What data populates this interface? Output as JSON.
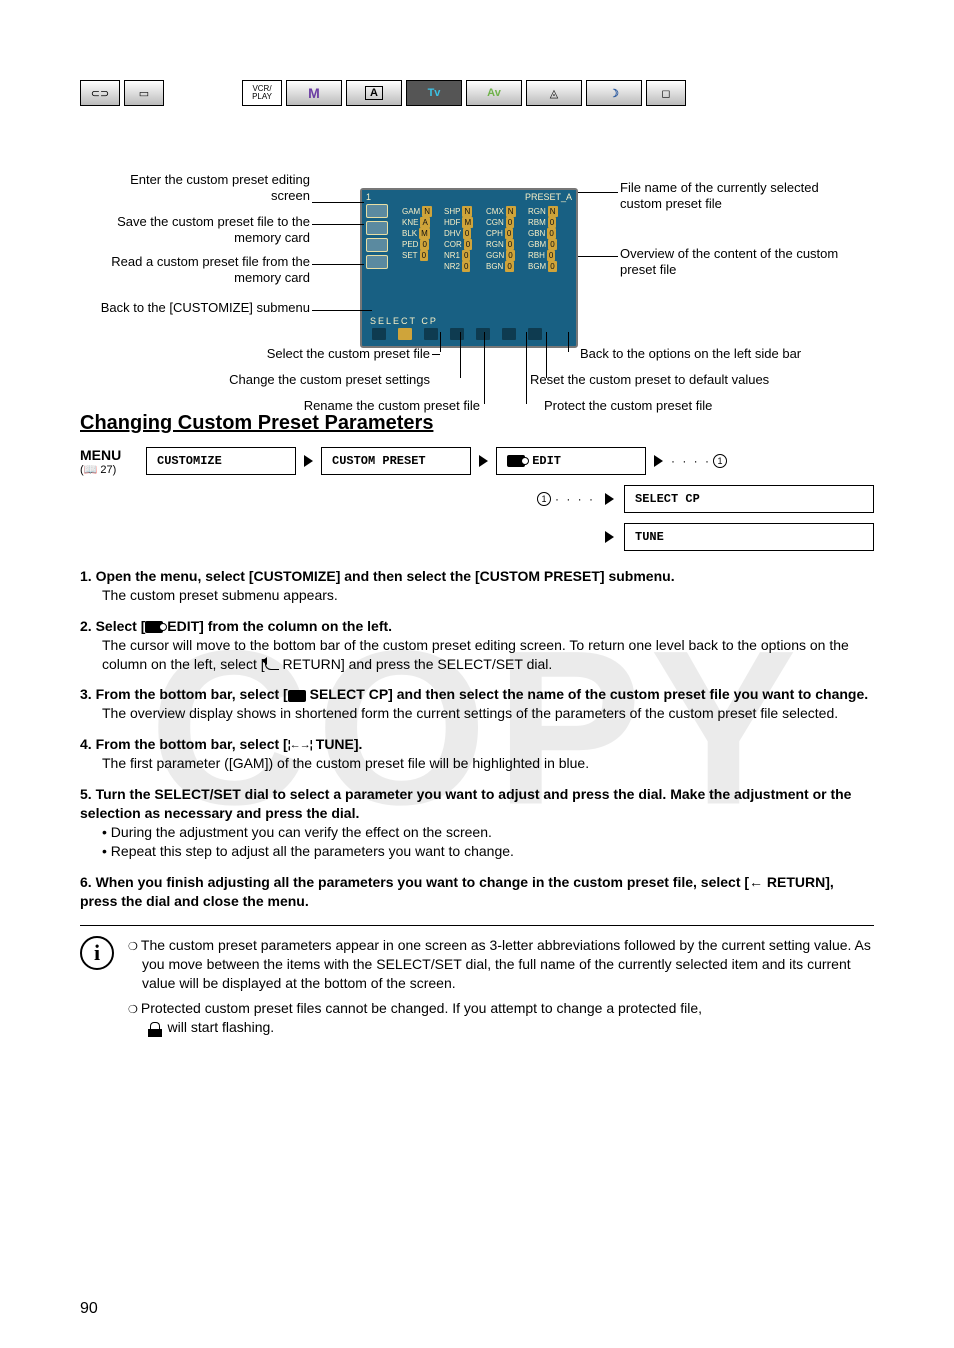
{
  "modebar": {
    "tape": "⊂⊃",
    "card": "▭",
    "vcr": "VCR/\nPLAY",
    "m": "M",
    "a": "A",
    "tv": "Tv",
    "av": "Av",
    "spot": "◬",
    "night": "☽",
    "rec": "◻"
  },
  "diagram": {
    "left": {
      "l1": "Enter the custom preset editing screen",
      "l2": "Save the custom preset file to the memory card",
      "l3": "Read a custom preset file from the memory card",
      "l4": "Back to the [CUSTOMIZE] submenu"
    },
    "right": {
      "r1": "File name of the currently selected custom preset file",
      "r2": "Overview of the content of the custom preset file"
    },
    "bottom": {
      "b1": "Select the custom preset file",
      "b2": "Change the custom preset settings",
      "b3": "Rename the custom preset file",
      "b4": "Protect the custom preset file",
      "b5": "Reset the custom preset to default values",
      "b6": "Back to the options on the left side bar"
    },
    "screen": {
      "title_num": "1",
      "title_name": "PRESET_A",
      "rows": [
        [
          [
            "GAM",
            "N"
          ],
          [
            "SHP",
            "N"
          ],
          [
            "CMX",
            "N"
          ],
          [
            "RGN",
            "N"
          ]
        ],
        [
          [
            "KNE",
            "A"
          ],
          [
            "HDF",
            "M"
          ],
          [
            "CGN",
            "0"
          ],
          [
            "RBM",
            "0"
          ]
        ],
        [
          [
            "BLK",
            "M"
          ],
          [
            "DHV",
            "0"
          ],
          [
            "CPH",
            "0"
          ],
          [
            "GBN",
            "0"
          ]
        ],
        [
          [
            "PED",
            "0"
          ],
          [
            "COR",
            "0"
          ],
          [
            "RGN",
            "0"
          ],
          [
            "GBM",
            "0"
          ]
        ],
        [
          [
            "SET",
            "0"
          ],
          [
            "NR1",
            "0"
          ],
          [
            "GGN",
            "0"
          ],
          [
            "RBH",
            "0"
          ]
        ],
        [
          [
            "",
            ""
          ],
          [
            "NR2",
            "0"
          ],
          [
            "BGN",
            "0"
          ],
          [
            "BGM",
            "0"
          ]
        ]
      ],
      "bottom_label": "SELECT CP"
    }
  },
  "section_heading": "Changing Custom Preset Parameters",
  "menupath": {
    "menu_label": "MENU",
    "pageref": "27",
    "b1": "CUSTOMIZE",
    "b2": "CUSTOM PRESET",
    "b3": "EDIT",
    "b4": "SELECT CP",
    "b5": "TUNE",
    "circ": "1"
  },
  "steps": [
    {
      "num": "1.",
      "title": "Open the menu, select [CUSTOMIZE] and then select the [CUSTOM PRESET] submenu.",
      "body": [
        "The custom preset submenu appears."
      ]
    },
    {
      "num": "2.",
      "title_pre": "Select [",
      "title_post": " EDIT] from the column on the left.",
      "body": [
        "The cursor will move to the bottom bar of the custom preset editing screen. To return one level back to the options on the column on the left, select [",
        " RETURN] and press the SELECT/SET dial."
      ]
    },
    {
      "num": "3.",
      "title_pre": "From the bottom bar, select [",
      "title_post": " SELECT CP] and then select the name of the custom preset file you want to change.",
      "body": [
        "The overview display shows in shortened form the current settings of the parameters of the custom preset file selected."
      ]
    },
    {
      "num": "4.",
      "title_pre": "From the bottom bar, select [",
      "title_post": " TUNE].",
      "body": [
        "The first parameter ([GAM]) of the custom preset file will be highlighted in blue."
      ]
    },
    {
      "num": "5.",
      "title": "Turn the SELECT/SET dial to select a parameter you want to adjust and press the dial. Make the adjustment or the selection as necessary and press the dial.",
      "bullets": [
        "During the adjustment you can verify the effect on the screen.",
        "Repeat this step to adjust all the parameters you want to change."
      ]
    },
    {
      "num": "6.",
      "title_pre": "When you finish adjusting all the parameters you want to change in the custom preset file, select [",
      "title_post": " RETURN], press the dial and close the menu."
    }
  ],
  "info": {
    "n1": "The custom preset parameters appear in one screen as 3-letter abbreviations followed by the current setting value. As you move between the items with the SELECT/SET dial, the full name of the currently selected item and its current value will be displayed at the bottom of the screen.",
    "n2a": "Protected custom preset files cannot be changed. If you attempt to change a protected file,",
    "n2b": " will start flashing."
  },
  "page_number": "90"
}
